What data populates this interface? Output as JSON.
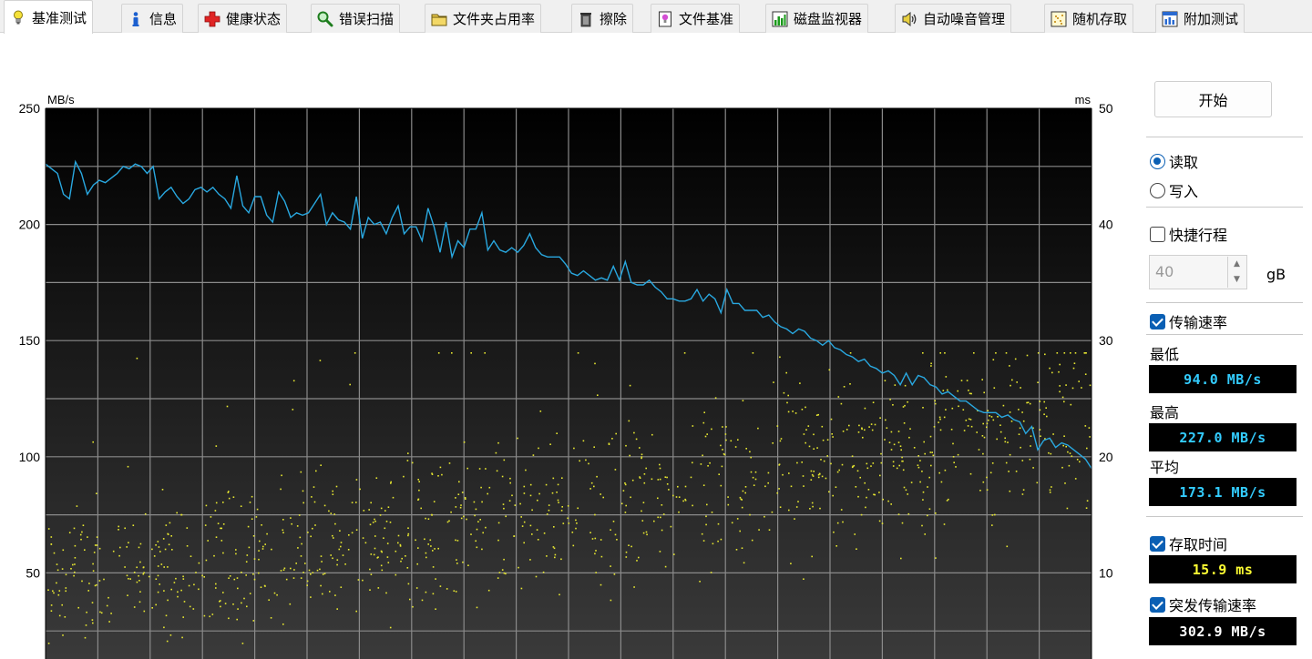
{
  "tabs": [
    {
      "label": "基准测试",
      "icon": "lightbulb-icon",
      "active": true
    },
    {
      "label": "信息",
      "icon": "info-icon",
      "active": false
    },
    {
      "label": "健康状态",
      "icon": "health-cross-icon",
      "active": false
    },
    {
      "label": "错误扫描",
      "icon": "magnifier-icon",
      "active": false
    },
    {
      "label": "文件夹占用率",
      "icon": "folder-icon",
      "active": false
    },
    {
      "label": "擦除",
      "icon": "trash-icon",
      "active": false
    },
    {
      "label": "文件基准",
      "icon": "file-benchmark-icon",
      "active": false
    },
    {
      "label": "磁盘监视器",
      "icon": "disk-monitor-icon",
      "active": false
    },
    {
      "label": "自动噪音管理",
      "icon": "speaker-icon",
      "active": false
    },
    {
      "label": "随机存取",
      "icon": "random-access-icon",
      "active": false
    },
    {
      "label": "附加测试",
      "icon": "extra-tests-icon",
      "active": false
    }
  ],
  "chart_data": {
    "type": "line",
    "left_axis": {
      "label": "MB/s",
      "range": [
        0,
        250
      ],
      "ticks": [
        50,
        100,
        150,
        200,
        250
      ]
    },
    "right_axis": {
      "label": "ms",
      "range": [
        0,
        50
      ],
      "ticks": [
        10,
        20,
        30,
        40,
        50
      ]
    },
    "grid": true,
    "transfer_rate_color": "#29a8e0",
    "access_time_color": "#e8e830",
    "transfer_rate_mbs": [
      226,
      224,
      222,
      213,
      211,
      227,
      222,
      213,
      217,
      219,
      218,
      220,
      222,
      225,
      224,
      226,
      225,
      222,
      225,
      211,
      214,
      216,
      212,
      209,
      211,
      215,
      216,
      214,
      216,
      213,
      211,
      207,
      221,
      208,
      205,
      212,
      212,
      204,
      201,
      214,
      210,
      203,
      205,
      204,
      205,
      209,
      213,
      200,
      205,
      202,
      201,
      198,
      212,
      194,
      203,
      200,
      201,
      196,
      203,
      208,
      196,
      199,
      199,
      193,
      207,
      199,
      188,
      201,
      186,
      193,
      190,
      198,
      198,
      205,
      189,
      193,
      189,
      188,
      190,
      188,
      191,
      196,
      190,
      187,
      186,
      186,
      186,
      183,
      179,
      178,
      180,
      178,
      176,
      177,
      176,
      182,
      176,
      184,
      175,
      174,
      174,
      176,
      173,
      171,
      168,
      168,
      167,
      167,
      168,
      172,
      167,
      170,
      168,
      162,
      172,
      166,
      166,
      163,
      163,
      163,
      160,
      161,
      158,
      156,
      155,
      153,
      155,
      154,
      151,
      150,
      148,
      150,
      147,
      146,
      144,
      143,
      141,
      142,
      139,
      138,
      136,
      137,
      135,
      131,
      136,
      131,
      135,
      134,
      131,
      130,
      127,
      128,
      126,
      124,
      124,
      122,
      120,
      119,
      119,
      119,
      117,
      118,
      116,
      115,
      110,
      113,
      103,
      107,
      108,
      104,
      106,
      105,
      103,
      101,
      99,
      95
    ],
    "access_time_samples_ms": {
      "min": 4,
      "max": 29,
      "note_points": 1120
    }
  },
  "panel": {
    "start_button": "开始",
    "read_label": "读取",
    "write_label": "写入",
    "read_selected": true,
    "short_stroke_label": "快捷行程",
    "short_stroke_checked": false,
    "short_stroke_value": "40",
    "short_stroke_unit": "gB",
    "transfer_rate_label": "传输速率",
    "transfer_rate_checked": true,
    "min_label": "最低",
    "min_value": "94.0 MB/s",
    "max_label": "最高",
    "max_value": "227.0 MB/s",
    "avg_label": "平均",
    "avg_value": "173.1 MB/s",
    "access_time_label": "存取时间",
    "access_time_checked": true,
    "access_time_value": "15.9 ms",
    "burst_rate_label": "突发传输速率",
    "burst_rate_checked": true,
    "burst_rate_value": "302.9 MB/s"
  }
}
